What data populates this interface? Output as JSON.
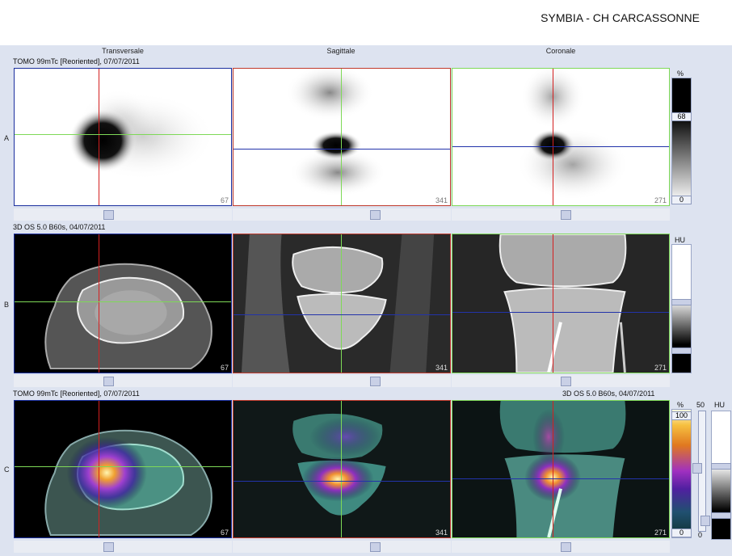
{
  "header": {
    "title": "SYMBIA - CH CARCASSONNE"
  },
  "view_headers": [
    "Transversale",
    "Sagittale",
    "Coronale"
  ],
  "rows": [
    {
      "label": "A",
      "series": "TOMO 99mTc [Reoriented], 07/07/2011",
      "unit": "%",
      "bar_top": "68",
      "bar_bottom": "0"
    },
    {
      "label": "B",
      "series": "3D  OS  5.0  B60s, 04/07/2011",
      "unit": "HU"
    },
    {
      "label": "C",
      "series": "TOMO 99mTc [Reoriented], 07/07/2011",
      "series_right": "3D  OS  5.0  B60s, 04/07/2011",
      "unit": "%",
      "bar_top": "100",
      "bar_bottom": "0",
      "unit2_top": "50",
      "unit2_bottom": "0",
      "unit3": "HU"
    }
  ],
  "slices": [
    "67",
    "341",
    "271"
  ],
  "colors": {
    "background": "#dde3f0",
    "transverse_border": "#1a2f9e",
    "sagittal_border": "#c0392b",
    "coronal_border": "#7ed957",
    "crosshair_red": "#d42020",
    "crosshair_green": "#7ed957",
    "crosshair_blue": "#2233aa"
  }
}
